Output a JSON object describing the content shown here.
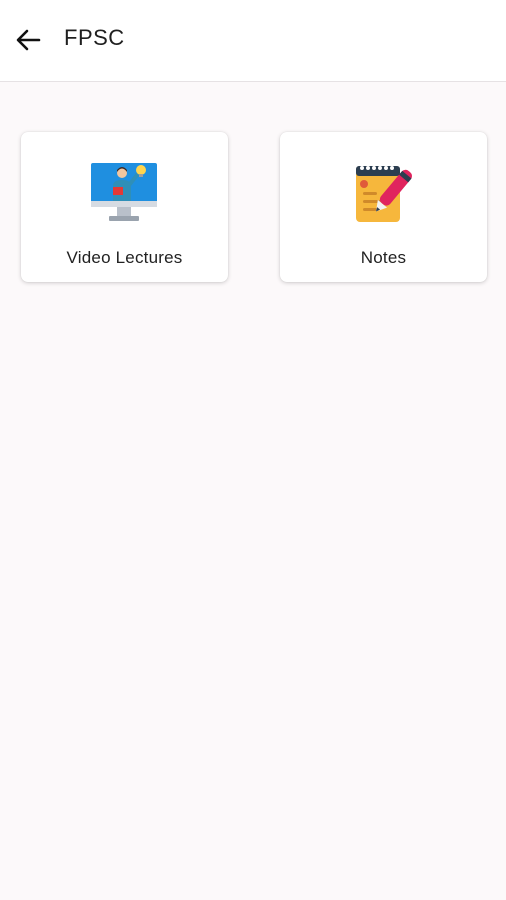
{
  "header": {
    "title": "FPSC",
    "back_icon": "arrow-left-icon"
  },
  "cards": [
    {
      "label": "Video Lectures",
      "icon": "video-lecture-monitor-icon"
    },
    {
      "label": "Notes",
      "icon": "notepad-pen-icon"
    }
  ],
  "colors": {
    "background": "#fcf9fa",
    "appbar": "#ffffff",
    "monitor_blue": "#1f8fe0",
    "notepad_yellow": "#f6b73c",
    "pen_pink": "#e0245e"
  }
}
